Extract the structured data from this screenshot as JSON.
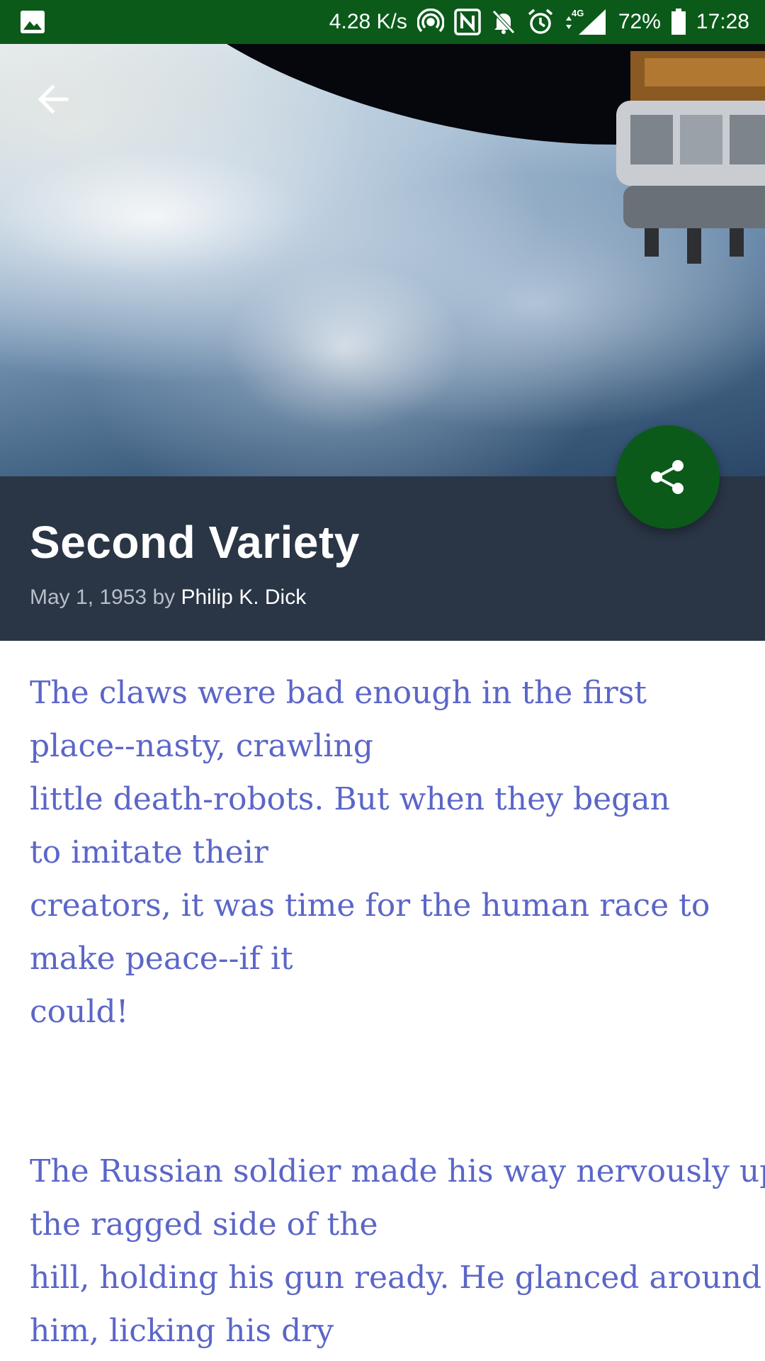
{
  "status_bar": {
    "net_speed": "4.28 K/s",
    "network_type": "4G",
    "battery": "72%",
    "time": "17:28",
    "icons": [
      "image-icon",
      "hotspot-icon",
      "nfc-icon",
      "mute-icon",
      "alarm-icon",
      "signal-icon",
      "battery-icon"
    ]
  },
  "header": {
    "title": "Second Variety",
    "date": "May 1, 1953",
    "by": "by",
    "author": "Philip K. Dick"
  },
  "colors": {
    "status_bar": "#0b5a1a",
    "header_bg": "#2a3545",
    "fab": "#0b5a1a",
    "body_text": "#5b66c8"
  },
  "article": {
    "paragraph1": [
      "The claws were bad enough in the first",
      "place--nasty, crawling",
      "little death-robots. But when they began",
      "to imitate their",
      "creators, it was time for the human race to",
      "make peace--if it",
      "could!"
    ],
    "paragraph2": [
      "The Russian soldier made his way nervously up",
      "the ragged side of the",
      "hill, holding his gun ready. He glanced around",
      "him, licking his dry"
    ]
  }
}
